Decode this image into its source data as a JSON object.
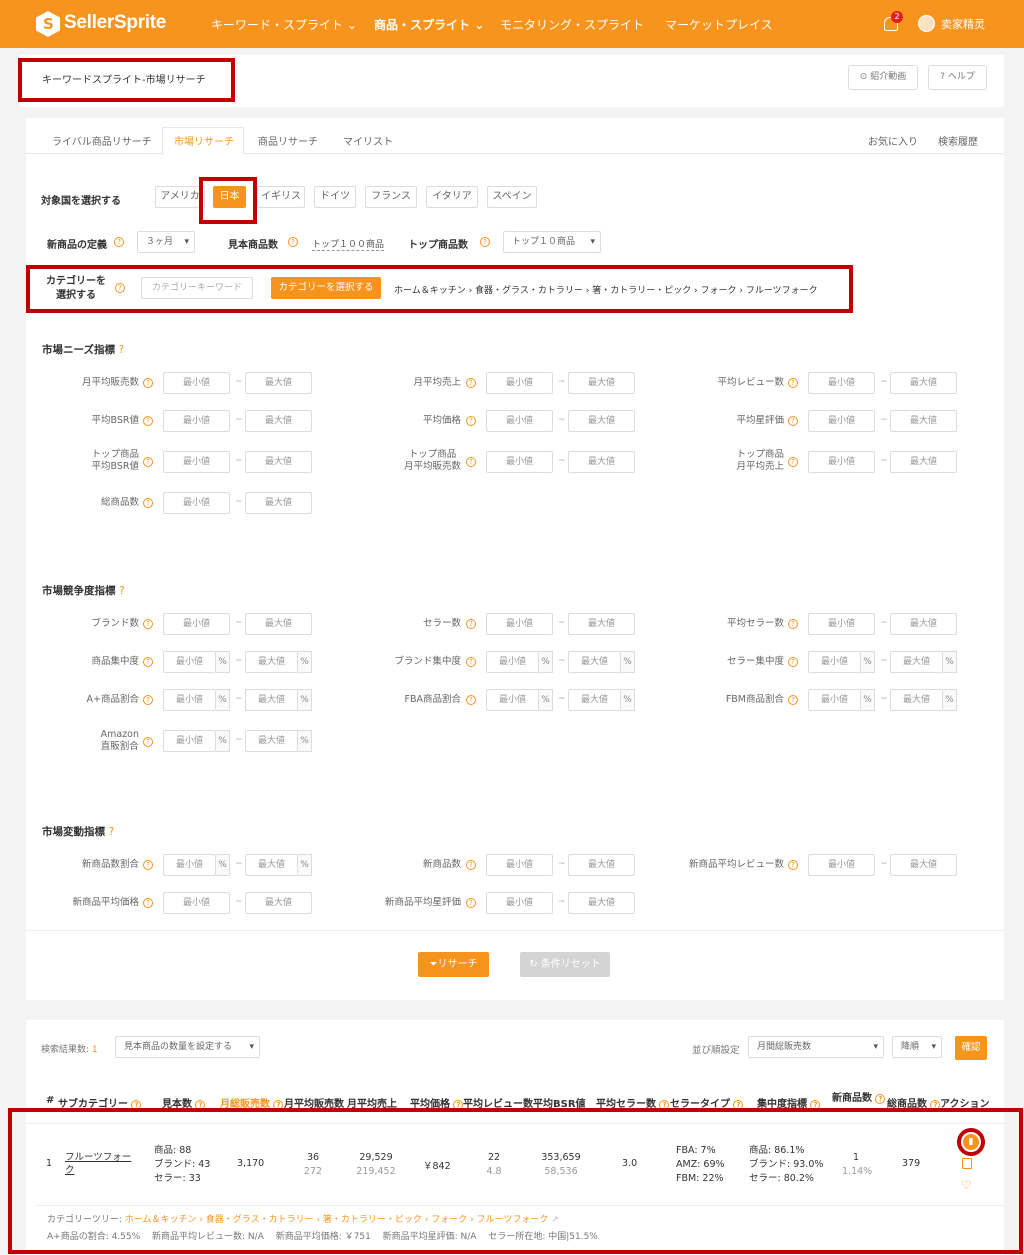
{
  "nav": {
    "brand": "SellerSprite",
    "items": [
      "キーワード・スプライト",
      "商品・スプライト",
      "モニタリング・スプライト",
      "マーケットプレイス"
    ],
    "badge": "2",
    "user": "卖家精灵"
  },
  "header": {
    "title": "キーワードスプライト-市場リサーチ",
    "video_btn": "紹介動画",
    "help_btn": "ヘルプ"
  },
  "tabs": [
    "ライバル商品リサーチ",
    "市場リサーチ",
    "商品リサーチ",
    "マイリスト"
  ],
  "tabs_right": [
    "お気に入り",
    "検索履歴"
  ],
  "country": {
    "label": "対象国を選択する",
    "options": [
      "アメリカ",
      "日本",
      "イギリス",
      "ドイツ",
      "フランス",
      "イタリア",
      "スペイン"
    ],
    "selected": "日本"
  },
  "defs": {
    "new_label": "新商品の定義",
    "new_value": "３ヶ月",
    "sample_label": "見本商品数",
    "sample_value": "トップ１００商品",
    "top_label": "トップ商品数",
    "top_value": "トップ１０商品"
  },
  "category": {
    "label1": "カテゴリーを",
    "label2": "選択する",
    "placeholder": "カテゴリーキーワード",
    "button": "カテゴリーを選択する",
    "path": "ホーム＆キッチン › 食器・グラス・カトラリー › 箸・カトラリー・ピック › フォーク › フルーツフォーク"
  },
  "ph": {
    "min": "最小値",
    "max": "最大値",
    "pct": "%",
    "dash": "~"
  },
  "needs": {
    "title": "市場ニーズ指標",
    "f1": "月平均販売数",
    "f2": "月平均売上",
    "f3": "平均レビュー数",
    "f4": "平均BSR値",
    "f5": "平均価格",
    "f6": "平均星評価",
    "f7a": "トップ商品",
    "f7b": "平均BSR値",
    "f8a": "トップ商品",
    "f8b": "月平均販売数",
    "f9a": "トップ商品",
    "f9b": "月平均売上",
    "f10": "総商品数"
  },
  "comp": {
    "title": "市場競争度指標",
    "f1": "ブランド数",
    "f2": "セラー数",
    "f3": "平均セラー数",
    "f4": "商品集中度",
    "f5": "ブランド集中度",
    "f6": "セラー集中度",
    "f7": "A+商品割合",
    "f8": "FBA商品割合",
    "f9": "FBM商品割合",
    "f10a": "Amazon",
    "f10b": "直販割合"
  },
  "change": {
    "title": "市場変動指標",
    "f1": "新商品数割合",
    "f2": "新商品数",
    "f3": "新商品平均レビュー数",
    "f4": "新商品平均価格",
    "f5": "新商品平均星評価"
  },
  "actions": {
    "search": "リサーチ",
    "reset": "条件リセット"
  },
  "results": {
    "count_label": "検索結果数: ",
    "count": "1",
    "sample_sel": "見本商品の数量を設定する",
    "sort_label": "並び順設定",
    "sort_value": "月間総販売数",
    "order": "降順",
    "confirm": "確認"
  },
  "table": {
    "headers": [
      "#",
      "サブカテゴリー",
      "見本数",
      "月総販売数",
      "月平均販売数",
      "月平均売上",
      "平均価格",
      "平均レビュー数",
      "平均BSR値",
      "平均セラー数",
      "セラータイプ",
      "集中度指標",
      "新商品数",
      "総商品数",
      "アクション"
    ],
    "row": {
      "idx": "1",
      "name": "フルーツフォーク",
      "s1": "商品: 88",
      "s2": "ブランド: 43",
      "s3": "セラー: 33",
      "total_sales": "3,170",
      "avg_sales": "36",
      "avg_sales_sub": "272",
      "avg_rev": "29,529",
      "avg_rev_sub": "219,452",
      "price": "￥842",
      "reviews": "22",
      "reviews_sub": "4.8",
      "bsr": "353,659",
      "bsr_sub": "58,536",
      "sellers": "3.0",
      "fba": "FBA: 7%",
      "amz": "AMZ: 69%",
      "fbm": "FBM: 22%",
      "c1": "商品: 86.1%",
      "c2": "ブランド: 93.0%",
      "c3": "セラー: 80.2%",
      "new_count": "1",
      "new_pct": "1.14%",
      "total": "379"
    },
    "tree_label": "カテゴリーツリー: ",
    "tree": "ホーム＆キッチン › 食器・グラス・カトラリー › 箸・カトラリー・ピック › フォーク › フルーツフォーク",
    "footer": "A+商品の割合: 4.55%　 新商品平均レビュー数: N/A　 新商品平均価格: ￥751　 新商品平均星評価: N/A　 セラー所在地: 中国|51.5%"
  },
  "colors": {
    "accent": "#f7941d",
    "highlight": "#c00000"
  }
}
